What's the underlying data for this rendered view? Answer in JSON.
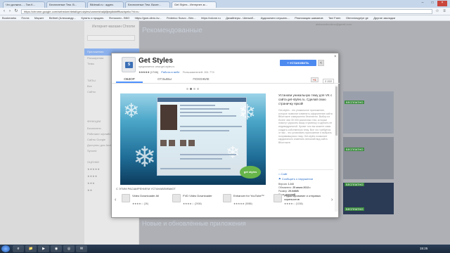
{
  "browser": {
    "tabs": [
      {
        "label": "Что должна... - Tan.K..."
      },
      {
        "label": "Бесплатные Тем. В..."
      },
      {
        "label": "Bildmail.ru : адрес."
      },
      {
        "label": "Бесплатные Тем. Вконт..."
      },
      {
        "label": "Get Styles - Интернет-м..."
      }
    ],
    "url": "https://chrome.google.com/webstore/detail/get-styles/cannmkhaljdljkejdkkbfffkachpekc?hl=ru",
    "bookmarks": [
      "Bookmarks",
      "Почта",
      "Маркет",
      "Beltnet (Александр...",
      "Купить и продать",
      "Фотоколи - ВКО",
      "https://gsm-clinic.kv...",
      "Federico Scavo - Brin...",
      "https://vdone.ru",
      "Дизайнеры - Шелкаб...",
      "Аудиокниги слушать...",
      "Реализация шаманов",
      "Tavi Farm",
      "Otmnniosyplye ge",
      "Другие закладки"
    ]
  },
  "store": {
    "title": "Интернет-магазин Chrome",
    "sidebar_items": [
      "Приложения",
      "Расширения",
      "Темы",
      "ТИПЫ",
      "Все",
      "Сайты",
      "ФУНКЦИИ",
      "Бесплатно",
      "Работают офлайн",
      "Сайты Google",
      "Доступно для Android",
      "Synced",
      "ОЦЕНКИ",
      "★★★★★",
      "★★★★",
      "★★★",
      "★★"
    ],
    "heading": "Рекомендованные",
    "heading_bottom": "Новые и обновлённые приложения",
    "user_email": "aleksandrvolkov@gmail.com",
    "bg_badges": [
      "БЕСПЛАТНО",
      "БЕСПЛАТНО",
      "БЕСПЛАТНО",
      "БЕСПЛАТНО"
    ]
  },
  "modal": {
    "app_name": "Get Styles",
    "app_icon_letter": "S",
    "provider": "предлагается: www.get-styles.ru",
    "stars": "★★★★★",
    "rating_count": "(1746)",
    "category": "Работа в вебе",
    "users": "Пользователей: 261 774",
    "install_label": "+ УСТАНОВИТЬ",
    "share_icon": "share-icon",
    "close": "×",
    "gplus_label": "+1",
    "gplus_count": "2 222",
    "tabs": [
      "ОБЗОР",
      "ОТЗЫВЫ",
      "ПОХОЖИЕ"
    ],
    "desc_title": "Установи уникальную тему для VK с сайта get-styles.ru. Сделай свою страничку яркой!",
    "desc_body": "Get-styles - это уникальное приложение, которое позволит изменить оформление сайта ВКонтакте совершенно бесплатно. Выбор из более чем 30 000 различных тем, которые помогут украсить вашу страничку и сделать ее индивидуальной. Кроме того вы можете сами создать собственную тему. Все что требуется от вас - это установить приложение и выбрать понравившуюся тему. Get-styles позволяет кардинально изменить внешний вид сайта ВКонтакте.",
    "site_label": "Сайт",
    "report_label": "Сообщить о нарушении",
    "meta": [
      {
        "k": "Версия:",
        "v": "1.0.8"
      },
      {
        "k": "Обновлено:",
        "v": "25 июля 2013 г."
      },
      {
        "k": "Размер:",
        "v": "29.04KiB"
      },
      {
        "k": "Язык:",
        "v": "русский"
      }
    ],
    "also_label": "С этим расширением устанавливают",
    "related": [
      {
        "name": "Video Downloader All",
        "stars": "★★★★☆ (26)"
      },
      {
        "name": "FVD Video Downloader",
        "stars": "★★★★☆ (2936)"
      },
      {
        "name": "Enhancer for YouTube™",
        "stars": "★★★★★ (5986)"
      },
      {
        "name": "Редактирование и отправка скриншотов",
        "stars": "★★★★☆ (1036)"
      }
    ],
    "screenshot_logo": "get styles"
  },
  "taskbar": {
    "clock": "15:25",
    "apps": [
      "e",
      "📁",
      "▶",
      "◉",
      "◎",
      "✉"
    ]
  }
}
